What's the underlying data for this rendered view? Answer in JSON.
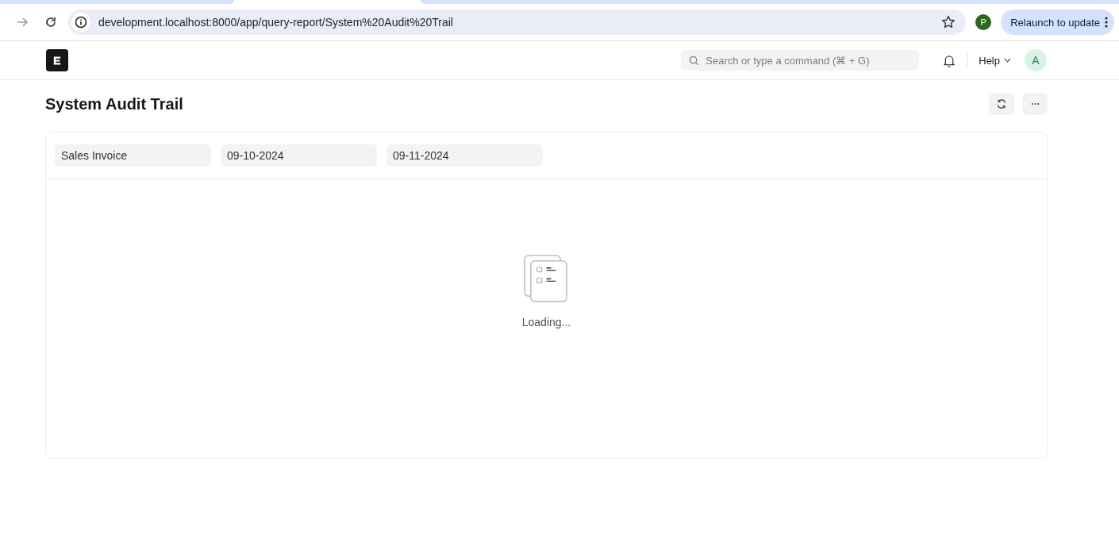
{
  "browser": {
    "url": "development.localhost:8000/app/query-report/System%20Audit%20Trail",
    "profile_initial": "P",
    "relaunch_label": "Relaunch to update"
  },
  "navbar": {
    "search_placeholder": "Search or type a command (⌘ + G)",
    "help_label": "Help",
    "avatar_initial": "A"
  },
  "page": {
    "title": "System Audit Trail"
  },
  "filters": [
    {
      "value": "Sales Invoice"
    },
    {
      "value": "09-10-2024"
    },
    {
      "value": "09-11-2024"
    }
  ],
  "report": {
    "message": "Loading..."
  }
}
